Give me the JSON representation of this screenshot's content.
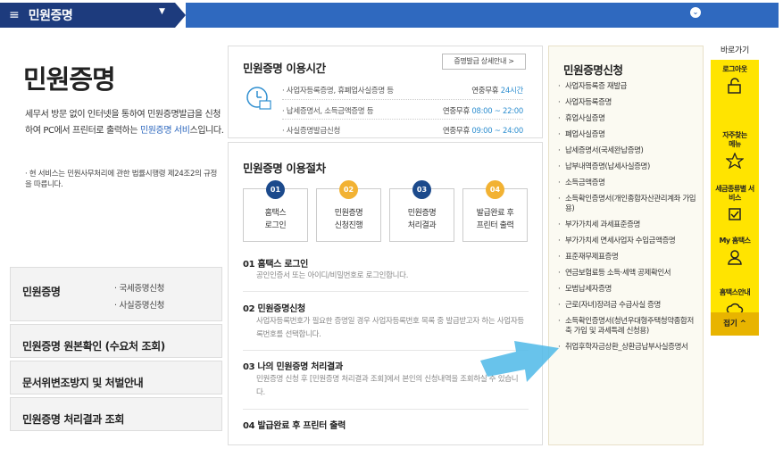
{
  "topbar": {
    "title": "민원증명"
  },
  "left": {
    "title": "민원증명",
    "desc_pre": "세무서 방문 없이 인터넷을 통하여 민원증명발급을 신청하여 PC에서 프린터로 출력하는 ",
    "desc_link": "민원증명 서비",
    "desc_post": "스입니다.",
    "note": "· 현 서비스는 민원사무처리에 관한 법률시행령 제24조2의 규정을 따릅니다."
  },
  "left_menu": {
    "item1": {
      "label": "민원증명",
      "sub1": "· 국세증명신청",
      "sub2": "· 사실증명신청"
    },
    "item2": "민원증명 원본확인 (수요처 조회)",
    "item3": "문서위변조방지 및 처벌안내",
    "item4": "민원증명 처리결과 조회"
  },
  "time_panel": {
    "title": "민원증명 이용시간",
    "guide_button": "증명발급 상세안내 >",
    "rows": [
      {
        "label": "· 사업자등록증명, 휴폐업사실증명 등",
        "pre": "연중무휴 ",
        "time": "24시간"
      },
      {
        "label": "· 납세증명서, 소득금액증명 등",
        "pre": "연중무휴 ",
        "time": "08:00 ~ 22:00"
      },
      {
        "label": "· 사실증명발급신청",
        "pre": "연중무휴 ",
        "time": "09:00 ~ 24:00"
      }
    ]
  },
  "process_panel": {
    "title": "민원증명 이용절차",
    "steps": [
      {
        "num": "01",
        "line1": "홈택스",
        "line2": "로그인"
      },
      {
        "num": "02",
        "line1": "민원증명",
        "line2": "신청진행"
      },
      {
        "num": "03",
        "line1": "민원증명",
        "line2": "처리결과"
      },
      {
        "num": "04",
        "line1": "발급완료 후",
        "line2": "프린터 출력"
      }
    ],
    "sections": [
      {
        "head": "01 홈택스 로그인",
        "desc": "공인인증서 또는 아이디/비밀번호로 로그인합니다."
      },
      {
        "head": "02 민원증명신청",
        "desc": "사업자등록번호가 필요한 증명일 경우 사업자등록번호 목록 중 발급받고자 하는 사업자등록번호를 선택합니다."
      },
      {
        "head": "03 나의 민원증명 처리결과",
        "desc": "민원증명 신청 후 [민원증명 처리결과 조회]에서 본인의 신청내역을 조회하실 수 있습니다."
      },
      {
        "head": "04 발급완료 후 프린터 출력",
        "desc": ""
      }
    ]
  },
  "apply_panel": {
    "title": "민원증명신청",
    "items": [
      "사업자등록증 재발급",
      "사업자등록증명",
      "휴업사실증명",
      "폐업사실증명",
      "납세증명서(국세완납증명)",
      "납부내역증명(납세사실증명)",
      "소득금액증명",
      "소득확인증명서(개인종합자산관리계좌 가입용)",
      "부가가치세 과세표준증명",
      "부가가치세 면세사업자 수입금액증명",
      "표준재무제표증명",
      "연금보험료등 소득·세액 공제확인서",
      "모범납세자증명",
      "근로(자녀)장려금 수급사실 증명",
      "소득확인증명서(청년우대형주택청약종합저축 가입 및 과세특례 신청용)",
      "취업후학자금상환_상환금납부사실증명서"
    ]
  },
  "quick": {
    "head": "바로가기",
    "items": [
      "로그아웃",
      "자주찾는 메뉴",
      "세금종류별 서비스",
      "My 홈택스",
      "홈택스안내"
    ],
    "close": "접기 ^",
    "colors": {
      "bg": "#ffe400",
      "close_bg": "#e8b400"
    }
  },
  "colors": {
    "navy": "#1d3b7d",
    "blue": "#2f69bf",
    "gold": "#f2b233",
    "arrow": "#4db8e8"
  }
}
